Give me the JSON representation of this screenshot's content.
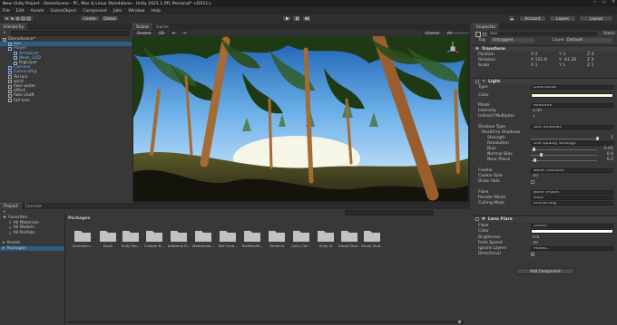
{
  "window": {
    "title": "New Unity Project - DemoScene - PC, Mac & Linux Standalone - Unity 2021.1.0f1 Personal* <DX11>",
    "min": "—",
    "max": "☐",
    "close": "✕"
  },
  "menu": [
    "File",
    "Edit",
    "Assets",
    "GameObject",
    "Component",
    "Jobs",
    "Window",
    "Help"
  ],
  "toolbar": {
    "pivot": "Center",
    "space": "Global",
    "account": "Account",
    "layers": "Layers",
    "layout": "Layout"
  },
  "hierarchy": {
    "tab": "Hierarchy",
    "add": "+",
    "rows": [
      {
        "label": "DemoScene*"
      },
      {
        "label": "sun"
      },
      {
        "label": "Player"
      },
      {
        "label": "Armature"
      },
      {
        "label": "Mesh_LOD"
      },
      {
        "label": "RigLayer"
      },
      {
        "label": "Camera"
      },
      {
        "label": "CameraRig"
      },
      {
        "label": "Terrain"
      },
      {
        "label": "wind"
      },
      {
        "label": "fake water"
      },
      {
        "label": "effect"
      },
      {
        "label": "fake shaft"
      },
      {
        "label": "fall tree"
      }
    ]
  },
  "scene": {
    "tabs": [
      "Scene",
      "Game"
    ],
    "shading": "Shaded",
    "mode": "2D",
    "gizmos": "Gizmos",
    "search": "All"
  },
  "project": {
    "tabs": [
      "Project",
      "Console"
    ],
    "add": "+",
    "tree": [
      {
        "label": "Favorites"
      },
      {
        "label": "All Materials"
      },
      {
        "label": "All Models"
      },
      {
        "label": "All Prefabs"
      },
      {
        "label": "Assets"
      },
      {
        "label": "Packages"
      }
    ],
    "path": "Packages",
    "folders": [
      "Animation...",
      "Burst",
      "Unity Ser...",
      "Custom N...",
      "JetBrains R...",
      "Mathemati...",
      "Test Fram...",
      "TextMeshP...",
      "Timeline",
      "Unity Coll...",
      "Unity UI",
      "Visual Stud...",
      "Visual Stud..."
    ]
  },
  "inspector": {
    "tab": "Inspector",
    "name": "sun",
    "static": "Static",
    "tag_label": "Tag",
    "tag": "Untagged",
    "layer_label": "Layer",
    "layer": "Default",
    "transform": {
      "title": "Transform",
      "rows": [
        {
          "label": "Position",
          "x": "0",
          "y": "3",
          "z": "0"
        },
        {
          "label": "Rotation",
          "x": "122.8",
          "y": "-41.28",
          "z": "0"
        },
        {
          "label": "Scale",
          "x": "1",
          "y": "1",
          "z": "1"
        }
      ]
    },
    "light": {
      "title": "Light",
      "rows": [
        {
          "label": "Type",
          "value": "Directional"
        },
        {
          "label": "Color",
          "value": ""
        },
        {
          "label": "Mode",
          "value": "Realtime"
        },
        {
          "label": "Intensity",
          "value": "2.45"
        },
        {
          "label": "Indirect Multiplier",
          "value": "1"
        },
        {
          "label": "Shadow Type",
          "value": "Soft Shadows"
        },
        {
          "label": "Realtime Shadows",
          "value": ""
        },
        {
          "label": "Strength",
          "value": "1"
        },
        {
          "label": "Resolution",
          "value": "Use Quality Settings"
        },
        {
          "label": "Bias",
          "value": "0.05"
        },
        {
          "label": "Normal Bias",
          "value": "0.4"
        },
        {
          "label": "Near Plane",
          "value": "0.2"
        },
        {
          "label": "Cookie",
          "value": "None (Texture)"
        },
        {
          "label": "Cookie Size",
          "value": "10"
        },
        {
          "label": "Draw Halo",
          "value": ""
        },
        {
          "label": "Flare",
          "value": "None (Flare)"
        },
        {
          "label": "Render Mode",
          "value": "Auto"
        },
        {
          "label": "Culling Mask",
          "value": "Everything"
        }
      ]
    },
    "lensflare": {
      "title": "Lens Flare",
      "rows": [
        {
          "label": "Flare",
          "value": "50mm"
        },
        {
          "label": "Color",
          "value": ""
        },
        {
          "label": "Brightness",
          "value": "0.6"
        },
        {
          "label": "Fade Speed",
          "value": "10"
        },
        {
          "label": "Ignore Layers",
          "value": "Mixed..."
        },
        {
          "label": "Directional",
          "value": ""
        }
      ]
    },
    "add_component": "Add Component"
  }
}
